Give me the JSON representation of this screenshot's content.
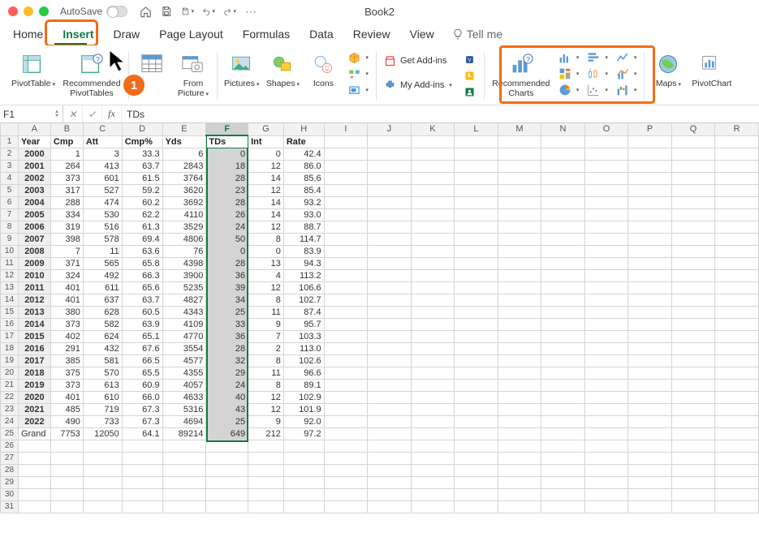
{
  "titlebar": {
    "autosave_label": "AutoSave",
    "doc_title": "Book2"
  },
  "tabs": {
    "home": "Home",
    "insert": "Insert",
    "draw": "Draw",
    "page_layout": "Page Layout",
    "formulas": "Formulas",
    "data": "Data",
    "review": "Review",
    "view": "View",
    "tell_me": "Tell me"
  },
  "ribbon": {
    "pivottable": "PivotTable",
    "rec_pivot": "Recommended\nPivotTables",
    "from_picture": "From\nPicture",
    "pictures": "Pictures",
    "shapes": "Shapes",
    "icons": "Icons",
    "get_addins": "Get Add-ins",
    "my_addins": "My Add-ins",
    "rec_charts": "Recommended\nCharts",
    "maps": "Maps",
    "pivotchart": "PivotChart"
  },
  "annotation": {
    "badge1": "1"
  },
  "formula_bar": {
    "name_box": "F1",
    "formula": "TDs"
  },
  "sheet": {
    "columns": [
      "A",
      "B",
      "C",
      "D",
      "E",
      "F",
      "G",
      "H",
      "I",
      "J",
      "K",
      "L",
      "M",
      "N",
      "O",
      "P",
      "Q",
      "R"
    ],
    "headers": [
      "Year",
      "Cmp",
      "Att",
      "Cmp%",
      "Yds",
      "TDs",
      "Int",
      "Rate"
    ],
    "rows": [
      {
        "year": "2000",
        "cmp": 1,
        "att": 3,
        "cmpp": "33.3",
        "yds": 6,
        "tds": 0,
        "int": 0,
        "rate": "42.4"
      },
      {
        "year": "2001",
        "cmp": 264,
        "att": 413,
        "cmpp": "63.7",
        "yds": 2843,
        "tds": 18,
        "int": 12,
        "rate": "86.0"
      },
      {
        "year": "2002",
        "cmp": 373,
        "att": 601,
        "cmpp": "61.5",
        "yds": 3764,
        "tds": 28,
        "int": 14,
        "rate": "85.6"
      },
      {
        "year": "2003",
        "cmp": 317,
        "att": 527,
        "cmpp": "59.2",
        "yds": 3620,
        "tds": 23,
        "int": 12,
        "rate": "85.4"
      },
      {
        "year": "2004",
        "cmp": 288,
        "att": 474,
        "cmpp": "60.2",
        "yds": 3692,
        "tds": 28,
        "int": 14,
        "rate": "93.2"
      },
      {
        "year": "2005",
        "cmp": 334,
        "att": 530,
        "cmpp": "62.2",
        "yds": 4110,
        "tds": 26,
        "int": 14,
        "rate": "93.0"
      },
      {
        "year": "2006",
        "cmp": 319,
        "att": 516,
        "cmpp": "61.3",
        "yds": 3529,
        "tds": 24,
        "int": 12,
        "rate": "88.7"
      },
      {
        "year": "2007",
        "cmp": 398,
        "att": 578,
        "cmpp": "69.4",
        "yds": 4806,
        "tds": 50,
        "int": 8,
        "rate": "114.7"
      },
      {
        "year": "2008",
        "cmp": 7,
        "att": 11,
        "cmpp": "63.6",
        "yds": 76,
        "tds": 0,
        "int": 0,
        "rate": "83.9"
      },
      {
        "year": "2009",
        "cmp": 371,
        "att": 565,
        "cmpp": "65.8",
        "yds": 4398,
        "tds": 28,
        "int": 13,
        "rate": "94.3"
      },
      {
        "year": "2010",
        "cmp": 324,
        "att": 492,
        "cmpp": "66.3",
        "yds": 3900,
        "tds": 36,
        "int": 4,
        "rate": "113.2"
      },
      {
        "year": "2011",
        "cmp": 401,
        "att": 611,
        "cmpp": "65.6",
        "yds": 5235,
        "tds": 39,
        "int": 12,
        "rate": "106.6"
      },
      {
        "year": "2012",
        "cmp": 401,
        "att": 637,
        "cmpp": "63.7",
        "yds": 4827,
        "tds": 34,
        "int": 8,
        "rate": "102.7"
      },
      {
        "year": "2013",
        "cmp": 380,
        "att": 628,
        "cmpp": "60.5",
        "yds": 4343,
        "tds": 25,
        "int": 11,
        "rate": "87.4"
      },
      {
        "year": "2014",
        "cmp": 373,
        "att": 582,
        "cmpp": "63.9",
        "yds": 4109,
        "tds": 33,
        "int": 9,
        "rate": "95.7"
      },
      {
        "year": "2015",
        "cmp": 402,
        "att": 624,
        "cmpp": "65.1",
        "yds": 4770,
        "tds": 36,
        "int": 7,
        "rate": "103.3"
      },
      {
        "year": "2016",
        "cmp": 291,
        "att": 432,
        "cmpp": "67.6",
        "yds": 3554,
        "tds": 28,
        "int": 2,
        "rate": "113.0"
      },
      {
        "year": "2017",
        "cmp": 385,
        "att": 581,
        "cmpp": "66.5",
        "yds": 4577,
        "tds": 32,
        "int": 8,
        "rate": "102.6"
      },
      {
        "year": "2018",
        "cmp": 375,
        "att": 570,
        "cmpp": "65.5",
        "yds": 4355,
        "tds": 29,
        "int": 11,
        "rate": "96.6"
      },
      {
        "year": "2019",
        "cmp": 373,
        "att": 613,
        "cmpp": "60.9",
        "yds": 4057,
        "tds": 24,
        "int": 8,
        "rate": "89.1"
      },
      {
        "year": "2020",
        "cmp": 401,
        "att": 610,
        "cmpp": "66.0",
        "yds": 4633,
        "tds": 40,
        "int": 12,
        "rate": "102.9"
      },
      {
        "year": "2021",
        "cmp": 485,
        "att": 719,
        "cmpp": "67.3",
        "yds": 5316,
        "tds": 43,
        "int": 12,
        "rate": "101.9"
      },
      {
        "year": "2022",
        "cmp": 490,
        "att": 733,
        "cmpp": "67.3",
        "yds": 4694,
        "tds": 25,
        "int": 9,
        "rate": "92.0"
      }
    ],
    "total": {
      "label": "Grand",
      "cmp": 7753,
      "att": 12050,
      "cmpp": "64.1",
      "yds": 89214,
      "tds": 649,
      "int": 212,
      "rate": "97.2"
    },
    "blank_rows_after": 6
  }
}
